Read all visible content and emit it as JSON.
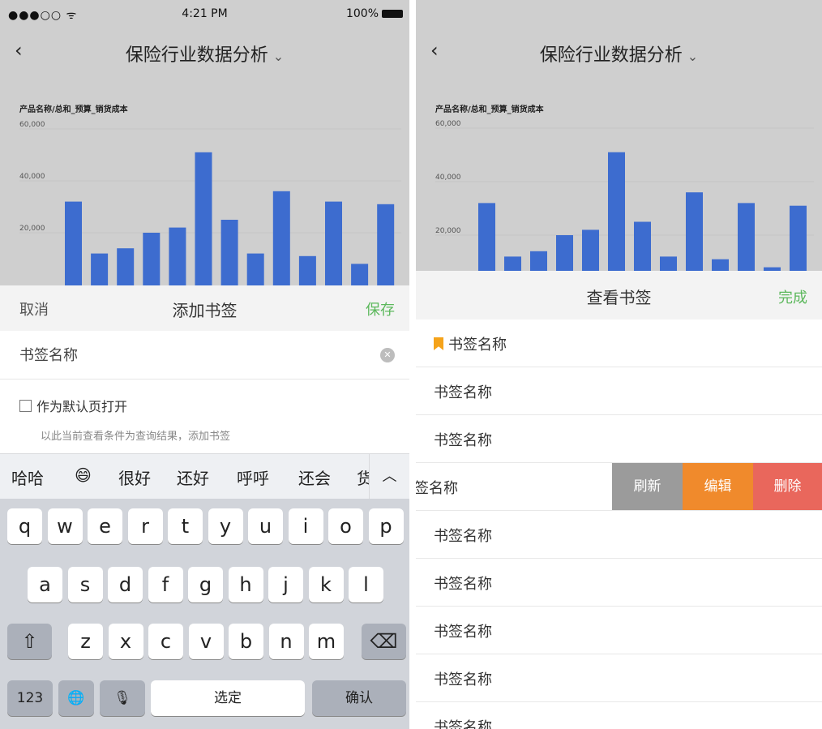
{
  "status_bar": {
    "signal": "●●●○○ ᯤ",
    "time": "4:21 PM",
    "battery": "100%"
  },
  "nav": {
    "back": "‹",
    "title": "保险行业数据分析",
    "chevron": "⌄"
  },
  "chart_data": {
    "type": "bar",
    "title": "产品名称/总和_预算_销货成本",
    "ylabel": "",
    "xlabel": "",
    "yticks": [
      "60,000",
      "40,000",
      "20,000"
    ],
    "ylim": [
      0,
      60000
    ],
    "grid": true,
    "values": [
      32000,
      12000,
      14000,
      20000,
      22000,
      51000,
      25000,
      12000,
      36000,
      11000,
      32000,
      8000,
      31000
    ],
    "colors": {
      "bar": "#3d6ccf",
      "background": "#cfcfcf"
    }
  },
  "add_bookmark": {
    "cancel": "取消",
    "title": "添加书签",
    "save": "保存",
    "name_placeholder": "书签名称",
    "default_open_label": "作为默认页打开",
    "hint": "以此当前查看条件为查询结果，添加书签"
  },
  "suggestions": [
    "哈哈",
    "😄",
    "很好",
    "还好",
    "呼呼",
    "还会",
    "货"
  ],
  "suggest_up": "︿",
  "keyboard": {
    "row1": [
      "q",
      "w",
      "e",
      "r",
      "t",
      "y",
      "u",
      "i",
      "o",
      "p"
    ],
    "row2": [
      "a",
      "s",
      "d",
      "f",
      "g",
      "h",
      "j",
      "k",
      "l"
    ],
    "row3": [
      "z",
      "x",
      "c",
      "v",
      "b",
      "n",
      "m"
    ],
    "shift": "⇧",
    "delete": "⌫",
    "numbers": "123",
    "globe": "🌐",
    "mic": "🎙",
    "space": "选定",
    "confirm": "确认"
  },
  "view_bookmarks": {
    "title": "查看书签",
    "done": "完成",
    "items": [
      "书签名称",
      "书签名称",
      "书签名称",
      "签名称",
      "书签名称",
      "书签名称",
      "书签名称",
      "书签名称",
      "书签名称"
    ],
    "actions": {
      "refresh": "刷新",
      "edit": "编辑",
      "delete": "删除"
    },
    "action_colors": {
      "refresh": "#9b9b9b",
      "edit": "#f08a2c",
      "delete": "#e9675c"
    }
  }
}
